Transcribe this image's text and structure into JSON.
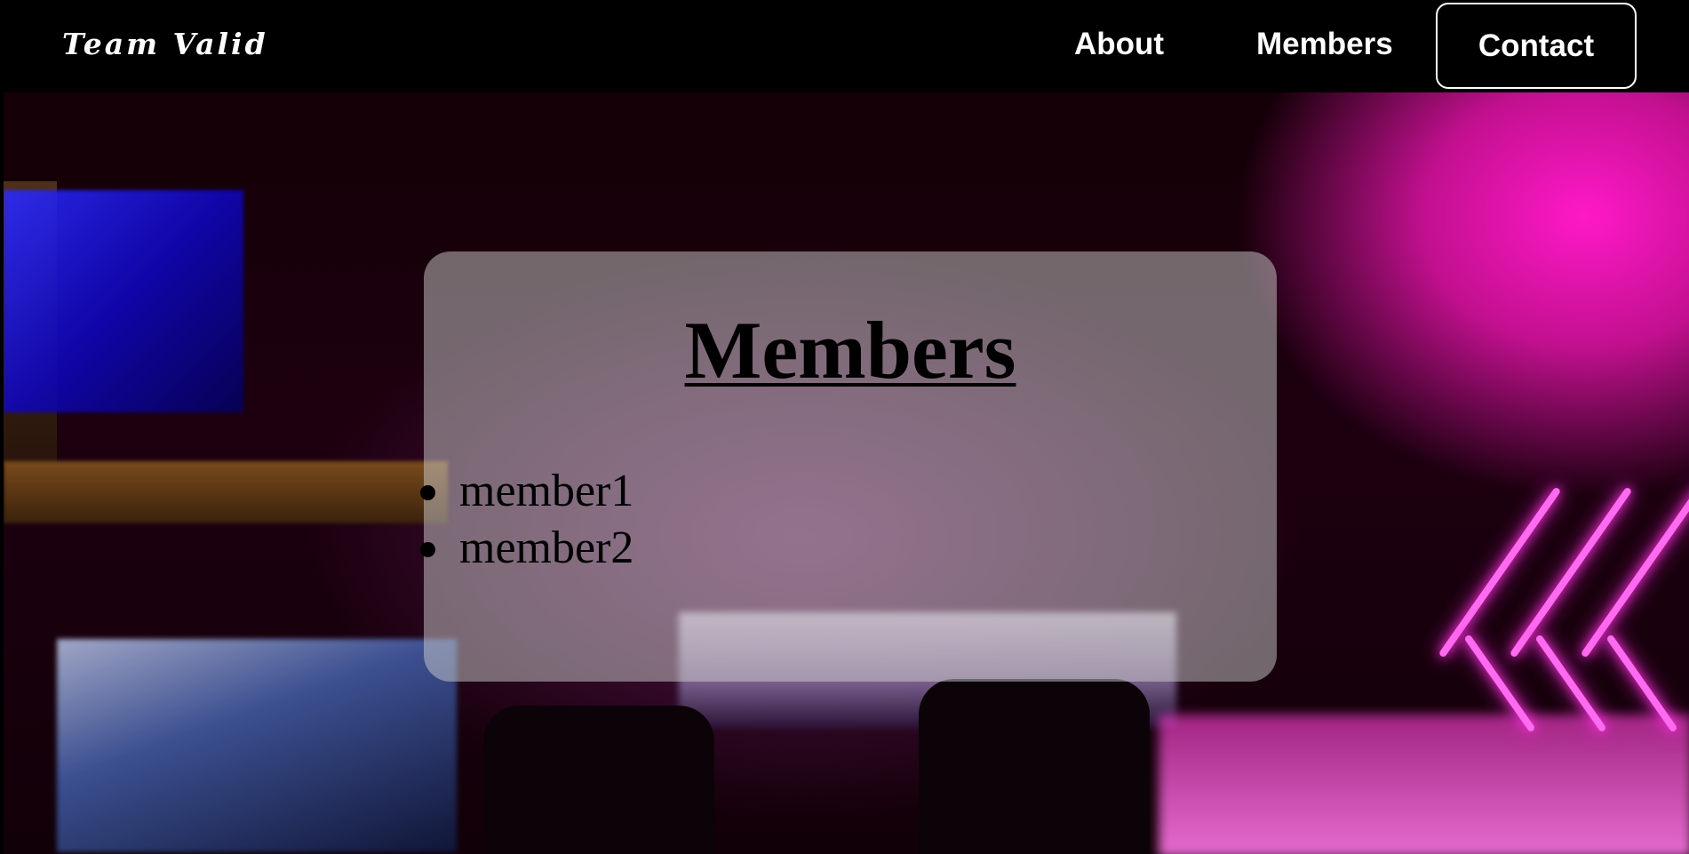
{
  "navbar": {
    "brand": "Team Valid",
    "links": {
      "about": "About",
      "members": "Members",
      "contact": "Contact"
    }
  },
  "card": {
    "title": "Members",
    "members": [
      "member1",
      "member2"
    ]
  },
  "colors": {
    "navbar_background": "#000000",
    "nav_text": "#ffffff",
    "card_background": "rgba(205,205,205,0.5)",
    "neon_accent": "#ff19c8"
  }
}
